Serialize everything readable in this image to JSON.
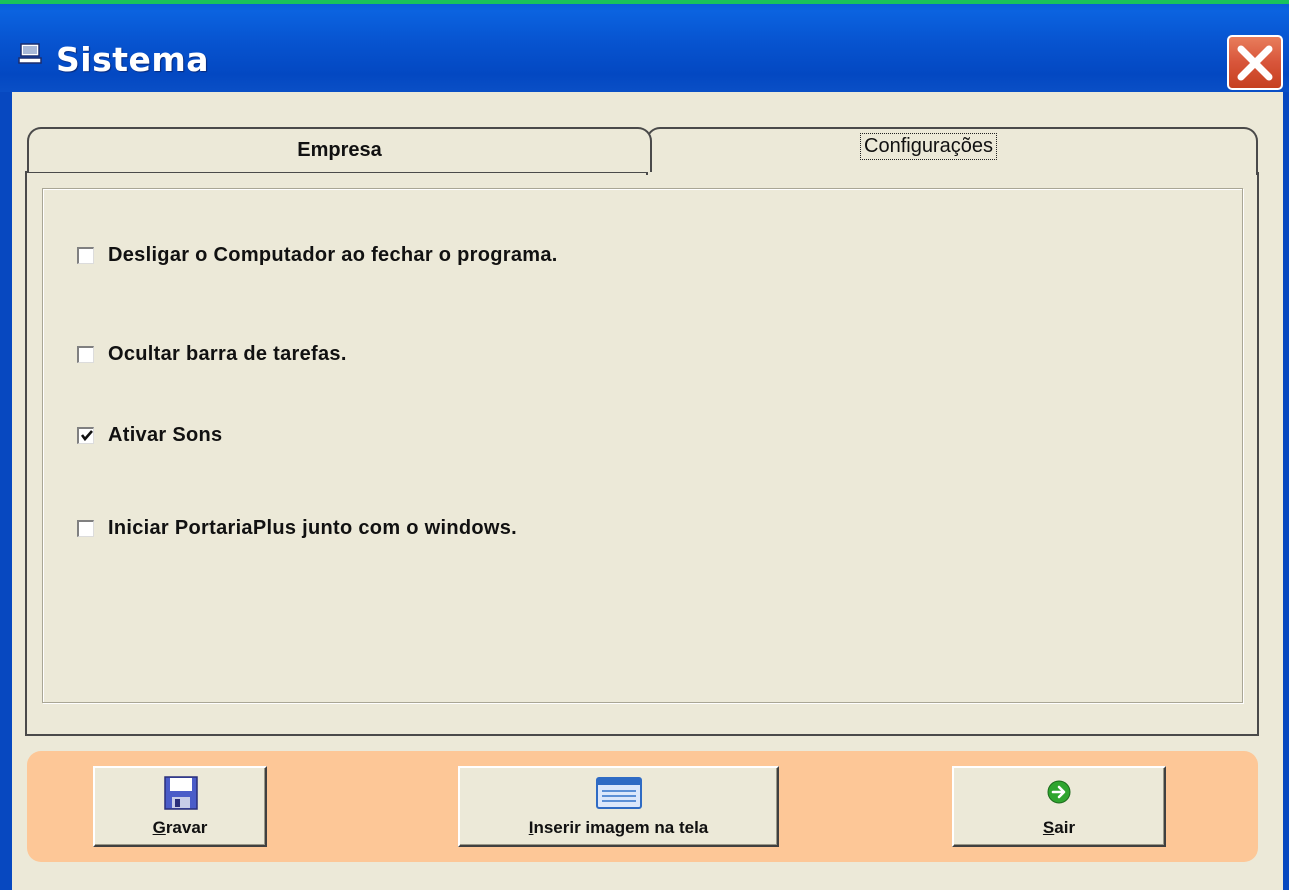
{
  "window": {
    "title": "Sistema"
  },
  "tabs": {
    "empresa_label": "Empresa",
    "configuracoes_label": "Configurações",
    "active": "Configurações"
  },
  "options": [
    {
      "label": "Desligar o Computador ao fechar o programa.",
      "checked": false
    },
    {
      "label": "Ocultar barra de tarefas.",
      "checked": false
    },
    {
      "label": "Ativar Sons",
      "checked": true
    },
    {
      "label": "Iniciar PortariaPlus junto com  o windows.",
      "checked": false
    }
  ],
  "buttons": {
    "gravar_label": "Gravar",
    "inserir_label": "Inserir imagem na tela",
    "sair_label": "Sair"
  },
  "icons": {
    "title": "monitor-icon",
    "close": "close-icon",
    "gravar": "floppy-disk-icon",
    "inserir": "image-window-icon",
    "sair": "green-arrow-icon"
  },
  "colors": {
    "titlebar": "#0753cf",
    "button_bar": "#fdc797",
    "close_button": "#d8553a",
    "background": "#ece9d8"
  }
}
